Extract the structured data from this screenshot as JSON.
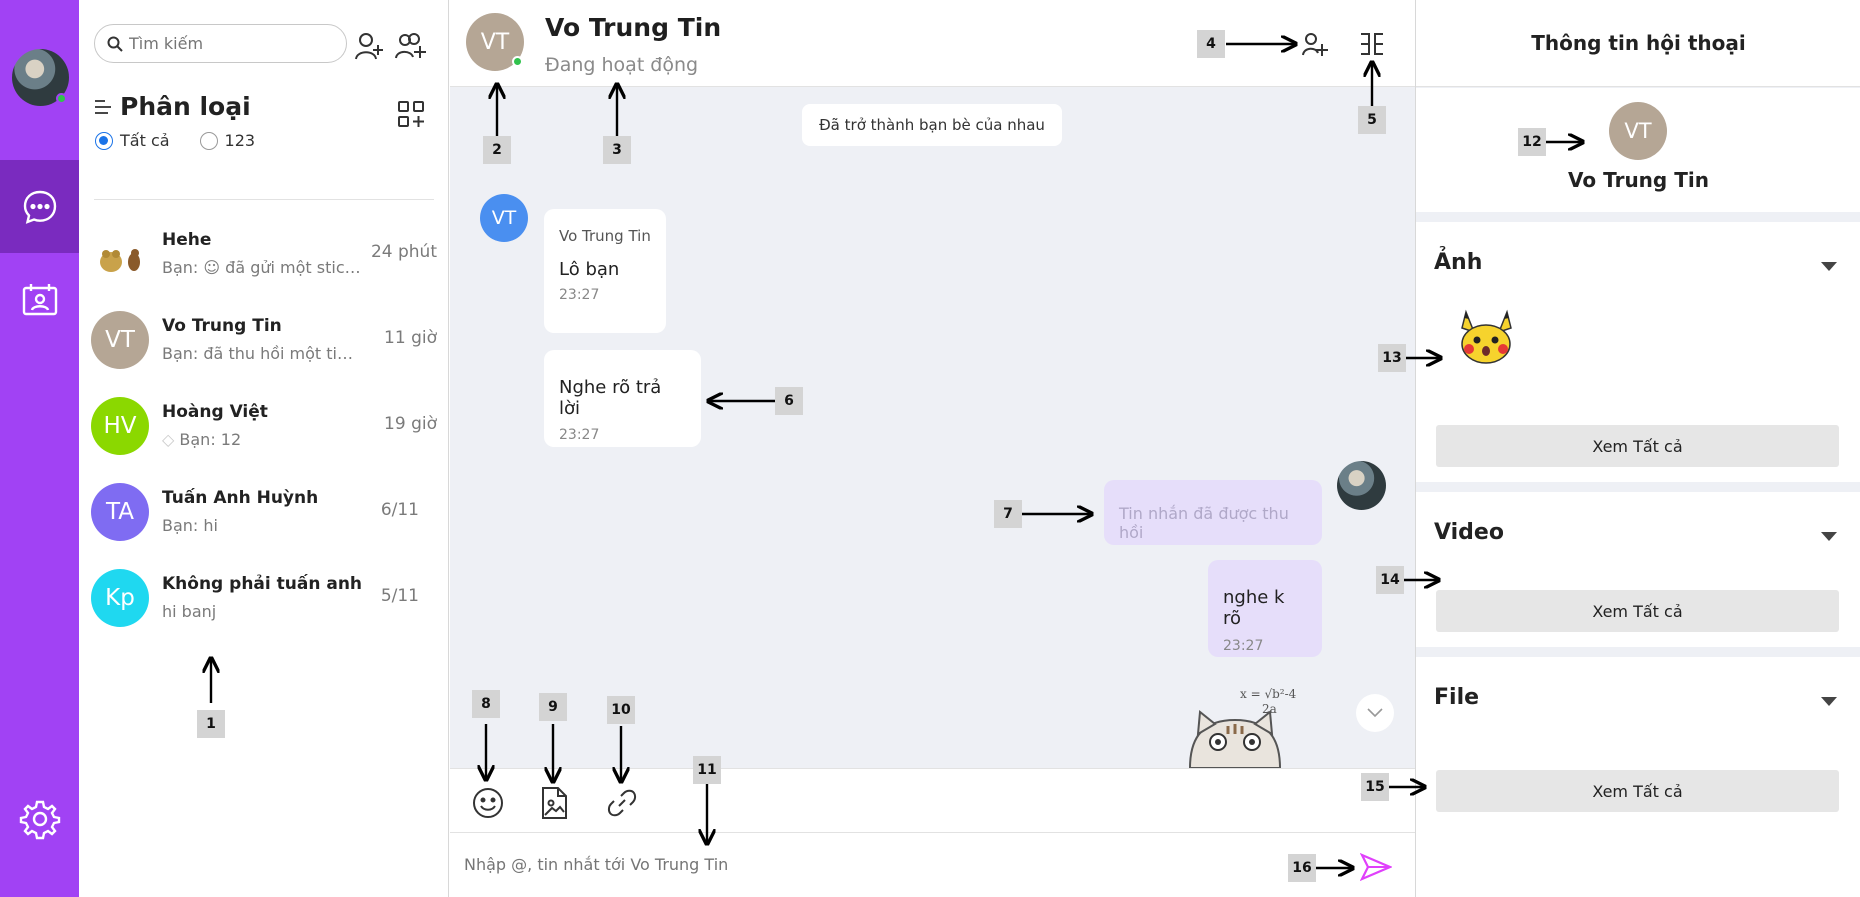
{
  "colors": {
    "rail": "#a142f4",
    "rail_active": "#7a2bbf",
    "online": "#31c24d",
    "accent": "#1a73e8",
    "send": "#e040fb"
  },
  "search": {
    "placeholder": "Tìm kiếm"
  },
  "filter": {
    "title": "Phân loại",
    "options": [
      "Tất cả",
      "123"
    ],
    "selected": "Tất cả"
  },
  "conversations": [
    {
      "initials": "",
      "name": "Hehe",
      "preview": "Bạn: ☺ đã gửi một sticker",
      "time": "24 phút",
      "color": "#ffffff"
    },
    {
      "initials": "VT",
      "name": "Vo Trung Tin",
      "preview": "Bạn: đã thu hồi một tin n...",
      "time": "11 giờ",
      "color": "#b5a695"
    },
    {
      "initials": "HV",
      "name": "Hoàng Việt",
      "preview": "Bạn: 12",
      "time": "19 giờ",
      "color": "#8bd800"
    },
    {
      "initials": "TA",
      "name": "Tuấn Anh Huỳnh",
      "preview": "Bạn: hi",
      "time": "6/11",
      "color": "#7f6cf2"
    },
    {
      "initials": "Kp",
      "name": "Không phải tuấn anh",
      "preview": "hi banj",
      "time": "5/11",
      "color": "#1fd8f0"
    }
  ],
  "chat": {
    "initials": "VT",
    "name": "Vo Trung Tin",
    "status": "Đang hoạt động",
    "system_message": "Đã trở thành bạn bè của nhau",
    "messages": [
      {
        "sender": "Vo Trung Tin",
        "text": "Lô bạn",
        "time": "23:27"
      },
      {
        "text": "Nghe rõ trả lời",
        "time": "23:27"
      },
      {
        "text": "Tin nhắn đã được thu hồi"
      },
      {
        "text": "nghe k rõ",
        "time": "23:27"
      }
    ],
    "composer_placeholder": "Nhập @, tin nhắt tới Vo Trung Tin"
  },
  "info": {
    "title": "Thông tin hội thoại",
    "initials": "VT",
    "name": "Vo Trung Tin",
    "sections": [
      {
        "title": "Ảnh",
        "see_all": "Xem Tất cả"
      },
      {
        "title": "Video",
        "see_all": "Xem Tất cả"
      },
      {
        "title": "File",
        "see_all": "Xem Tất cả"
      }
    ]
  },
  "annotations": [
    "1",
    "2",
    "3",
    "4",
    "5",
    "6",
    "7",
    "8",
    "9",
    "10",
    "11",
    "12",
    "13",
    "14",
    "15",
    "16"
  ]
}
